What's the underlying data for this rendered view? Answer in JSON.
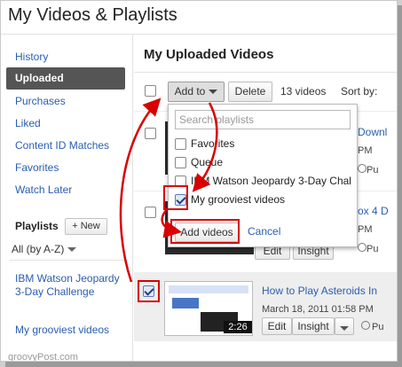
{
  "page": {
    "title": "My Videos & Playlists"
  },
  "sidebar": {
    "items": [
      {
        "label": "History"
      },
      {
        "label": "Uploaded"
      },
      {
        "label": "Purchases"
      },
      {
        "label": "Liked"
      },
      {
        "label": "Content ID Matches"
      },
      {
        "label": "Favorites"
      },
      {
        "label": "Watch Later"
      }
    ],
    "playlists_header": "Playlists",
    "new_button": "+ New",
    "sort_value": "All (by A-Z)",
    "playlists": [
      {
        "label": "IBM Watson Jeopardy 3-Day Challenge"
      },
      {
        "label": "My grooviest videos"
      }
    ]
  },
  "main": {
    "title": "My Uploaded Videos",
    "toolbar": {
      "add_to_label": "Add to",
      "delete_label": "Delete",
      "video_count": "13 videos",
      "sort_by_label": "Sort by:"
    },
    "rows": [
      {
        "title": "Downl",
        "meta": "PM",
        "meta2": "Pu"
      },
      {
        "title": "ox 4 D",
        "meta": "PM",
        "meta2": "Pu"
      },
      {
        "title": "How to Play Asteroids In",
        "meta": "March 18, 2011 01:58 PM",
        "meta2": "Pu",
        "duration": "2:26",
        "edit_label": "Edit",
        "insight_label": "Insight"
      }
    ],
    "row_buttons": {
      "edit_label": "Edit",
      "insight_label": "Insight"
    }
  },
  "dropdown": {
    "search_placeholder": "Search playlists",
    "playlists": [
      {
        "label": "Favorites",
        "checked": false
      },
      {
        "label": "Queue",
        "checked": false
      },
      {
        "label": "IBM Watson Jeopardy 3-Day Chal",
        "checked": false
      },
      {
        "label": "My grooviest videos",
        "checked": true
      }
    ],
    "add_button": "Add videos",
    "cancel_label": "Cancel"
  },
  "colors": {
    "link": "#2a5db0",
    "selected_nav_bg": "#555555",
    "highlight": "#d90000"
  },
  "watermark": "groovyPost.com"
}
